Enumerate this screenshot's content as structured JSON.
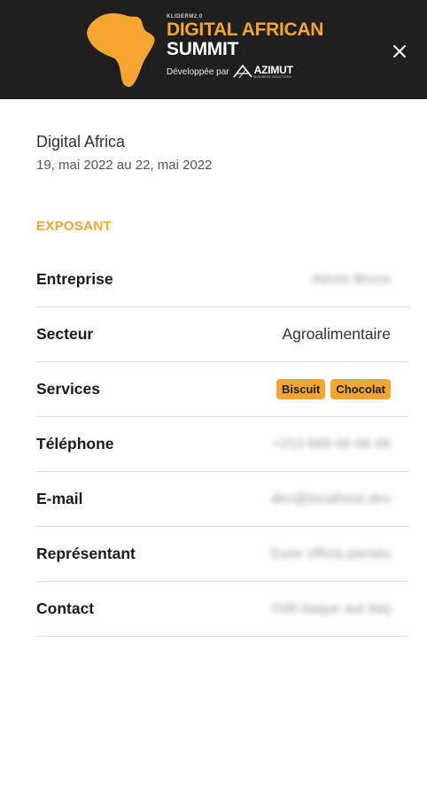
{
  "header": {
    "logo_small_text": "KLIDERM2.0",
    "title_line1": "DIGITAL AFRICAN",
    "title_line2": "SUMMIT",
    "developed_by": "Développée par",
    "partner_name": "AZIMUT",
    "partner_sub": "BUSINESS SOLUTIONS",
    "close_icon": "close-icon",
    "accent_color": "#f6a531",
    "background_color": "#1f1f1f"
  },
  "event": {
    "name": "Digital Africa",
    "dates": "19, mai 2022 au 22, mai 2022"
  },
  "section": {
    "title": "EXPOSANT"
  },
  "details": {
    "entreprise": {
      "label": "Entreprise",
      "value": "Alexis Bruce"
    },
    "secteur": {
      "label": "Secteur",
      "value": "Agroalimentaire"
    },
    "services": {
      "label": "Services",
      "tags": [
        "Biscuit",
        "Chocolat"
      ]
    },
    "telephone": {
      "label": "Téléphone",
      "value": "+213 666 66 66 66"
    },
    "email": {
      "label": "E-mail",
      "value": "dev@localhost.dev"
    },
    "representant": {
      "label": "Représentant",
      "value": "Esse officia pariatu"
    },
    "contact": {
      "label": "Contact",
      "value": "Odit itaque aut itaq"
    }
  }
}
